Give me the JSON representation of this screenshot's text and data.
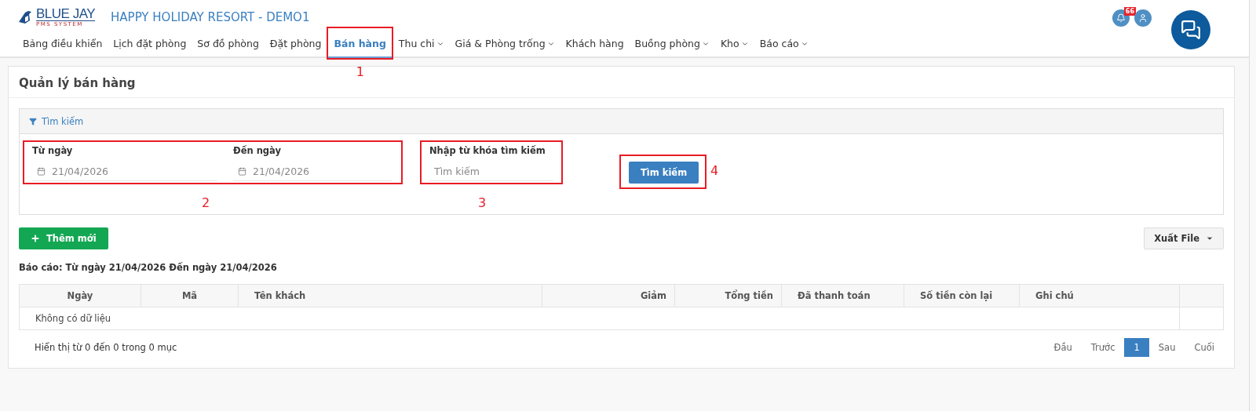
{
  "header": {
    "logo_name": "BLUE JAY",
    "logo_sub": "PMS SYSTEM",
    "title": "HAPPY HOLIDAY RESORT - DEMO1",
    "notification_count": "66"
  },
  "nav": [
    {
      "label": "Bảng điều khiển",
      "selected": false,
      "dropdown": false
    },
    {
      "label": "Lịch đặt phòng",
      "selected": false,
      "dropdown": false
    },
    {
      "label": "Sơ đồ phòng",
      "selected": false,
      "dropdown": false
    },
    {
      "label": "Đặt phòng",
      "selected": false,
      "dropdown": false
    },
    {
      "label": "Bán hàng",
      "selected": true,
      "dropdown": false,
      "callout": "1"
    },
    {
      "label": "Thu chi",
      "selected": false,
      "dropdown": true
    },
    {
      "label": "Giá & Phòng trống",
      "selected": false,
      "dropdown": true
    },
    {
      "label": "Khách hàng",
      "selected": false,
      "dropdown": false
    },
    {
      "label": "Buồng phòng",
      "selected": false,
      "dropdown": true
    },
    {
      "label": "Kho",
      "selected": false,
      "dropdown": true
    },
    {
      "label": "Báo cáo",
      "selected": false,
      "dropdown": true
    }
  ],
  "page_title": "Quản lý bán hàng",
  "search_panel": {
    "heading": "Tìm kiếm",
    "dates_callout": "2",
    "from": {
      "label": "Từ ngày",
      "value": "21/04/2026"
    },
    "to": {
      "label": "Đến ngày",
      "value": "21/04/2026"
    },
    "keyword": {
      "label": "Nhập từ khóa tìm kiếm",
      "placeholder": "Tìm kiếm",
      "callout": "3"
    },
    "button": {
      "label": "Tìm kiếm",
      "callout": "4"
    }
  },
  "add_button": "Thêm mới",
  "export_button": "Xuất File",
  "report_caption": "Báo cáo: Từ ngày 21/04/2026 Đến ngày 21/04/2026",
  "table": {
    "columns": [
      "Ngày",
      "Mã",
      "Tên khách",
      "Giảm",
      "Tổng tiền",
      "Đã thanh toán",
      "Số tiền còn lại",
      "Ghi chú"
    ],
    "empty_message": "Không có dữ liệu"
  },
  "footer": {
    "info": "Hiển thị từ 0 đến 0 trong 0 mục",
    "pages": [
      {
        "label": "Đầu",
        "selected": false
      },
      {
        "label": "Trước",
        "selected": false
      },
      {
        "label": "1",
        "selected": true
      },
      {
        "label": "Sau",
        "selected": false
      },
      {
        "label": "Cuối",
        "selected": false
      }
    ]
  }
}
